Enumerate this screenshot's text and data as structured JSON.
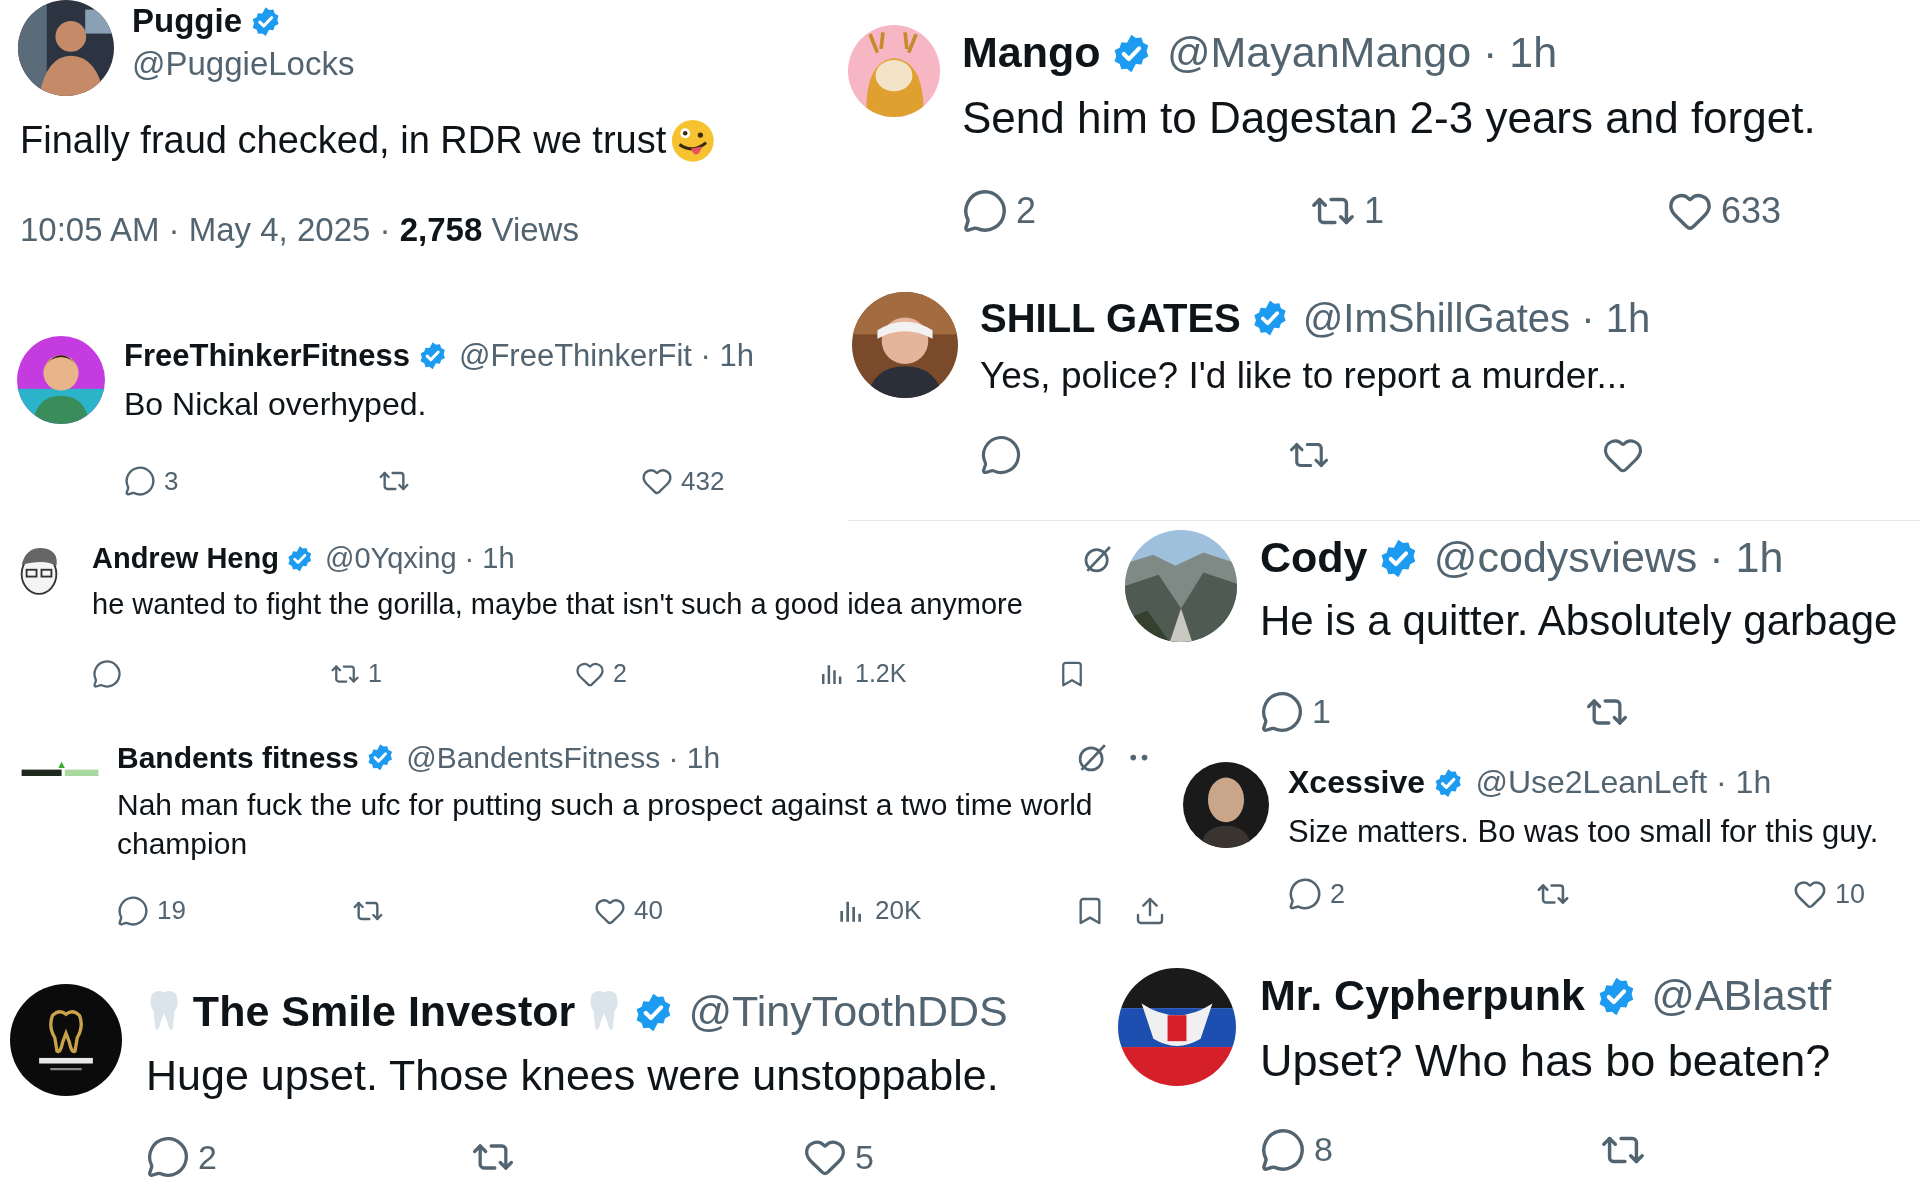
{
  "tweets": [
    {
      "kind": "main",
      "name": "Puggie",
      "verified": true,
      "meta": "@PuggieLocks",
      "text": "Finally fraud checked, in RDR we trust",
      "emoji": true,
      "stats": "10:05 AM · May 4, 2025 · **2,758** Views"
    },
    {
      "kind": "reply",
      "name": "FreeThinkerFitness",
      "verified": true,
      "meta": "@FreeThinkerFit · 1h",
      "text": "Bo Nickal overhyped.",
      "actions": [
        {
          "kind": "reply",
          "count": "3"
        },
        {
          "kind": "repost"
        },
        {
          "kind": "like",
          "count": "432"
        }
      ]
    },
    {
      "kind": "reply",
      "name": "Andrew Heng",
      "verified": true,
      "meta": "@0Yqxing · 1h",
      "menu": [
        {
          "kind": "grok"
        }
      ],
      "text": "he wanted to fight the gorilla, maybe that isn't such a good idea anymore",
      "actions": [
        {
          "kind": "reply"
        },
        {
          "kind": "repost",
          "count": "1"
        },
        {
          "kind": "like",
          "count": "2"
        },
        {
          "kind": "views",
          "count": "1.2K"
        },
        {
          "kind": "bookmark"
        }
      ]
    },
    {
      "kind": "reply",
      "name": "Bandents fitness",
      "verified": true,
      "meta": "@BandentsFitness · 1h",
      "menu": [
        {
          "kind": "grok"
        },
        {
          "kind": "more"
        }
      ],
      "text": "Nah man fuck the ufc for putting such a prospect against a two time world champion",
      "actions": [
        {
          "kind": "reply",
          "count": "19"
        },
        {
          "kind": "repost"
        },
        {
          "kind": "like",
          "count": "40"
        },
        {
          "kind": "views",
          "count": "20K"
        },
        {
          "kind": "bookmark"
        },
        {
          "kind": "share"
        }
      ]
    },
    {
      "kind": "reply",
      "name": "The Smile Investor",
      "name_emoji": true,
      "verified": true,
      "meta": "@TinyToothDDS",
      "text": "Huge upset. Those knees were unstoppable.",
      "actions": [
        {
          "kind": "reply",
          "count": "2"
        },
        {
          "kind": "repost"
        },
        {
          "kind": "like",
          "count": "5"
        }
      ]
    },
    {
      "kind": "reply",
      "name": "Mango",
      "verified": true,
      "meta": "@MayanMango · 1h",
      "text": "Send him to Dagestan 2-3 years and forget.",
      "actions": [
        {
          "kind": "reply",
          "count": "2"
        },
        {
          "kind": "repost",
          "count": "1"
        },
        {
          "kind": "like",
          "count": "633"
        }
      ]
    },
    {
      "kind": "reply",
      "name": "SHILL GATES",
      "verified": true,
      "meta": "@ImShillGates · 1h",
      "text": "Yes, police? I'd like to report a murder...",
      "actions": [
        {
          "kind": "reply"
        },
        {
          "kind": "repost"
        },
        {
          "kind": "like"
        }
      ]
    },
    {
      "kind": "reply",
      "name": "Cody",
      "verified": true,
      "meta": "@codysviews · 1h",
      "text": "He is a quitter. Absolutely garbage",
      "actions": [
        {
          "kind": "reply",
          "count": "1"
        },
        {
          "kind": "repost"
        }
      ]
    },
    {
      "kind": "reply",
      "name": "Xcessive",
      "verified": true,
      "meta": "@Use2LeanLeft · 1h",
      "text": "Size matters. Bo was too small for this guy.",
      "actions": [
        {
          "kind": "reply",
          "count": "2"
        },
        {
          "kind": "repost"
        },
        {
          "kind": "like",
          "count": "10"
        }
      ]
    },
    {
      "kind": "reply",
      "name": "Mr. Cypherpunk",
      "verified": true,
      "meta": "@ABlastf",
      "text": "Upset? Who has bo beaten?",
      "actions": [
        {
          "kind": "reply",
          "count": "8"
        },
        {
          "kind": "repost"
        }
      ]
    }
  ]
}
